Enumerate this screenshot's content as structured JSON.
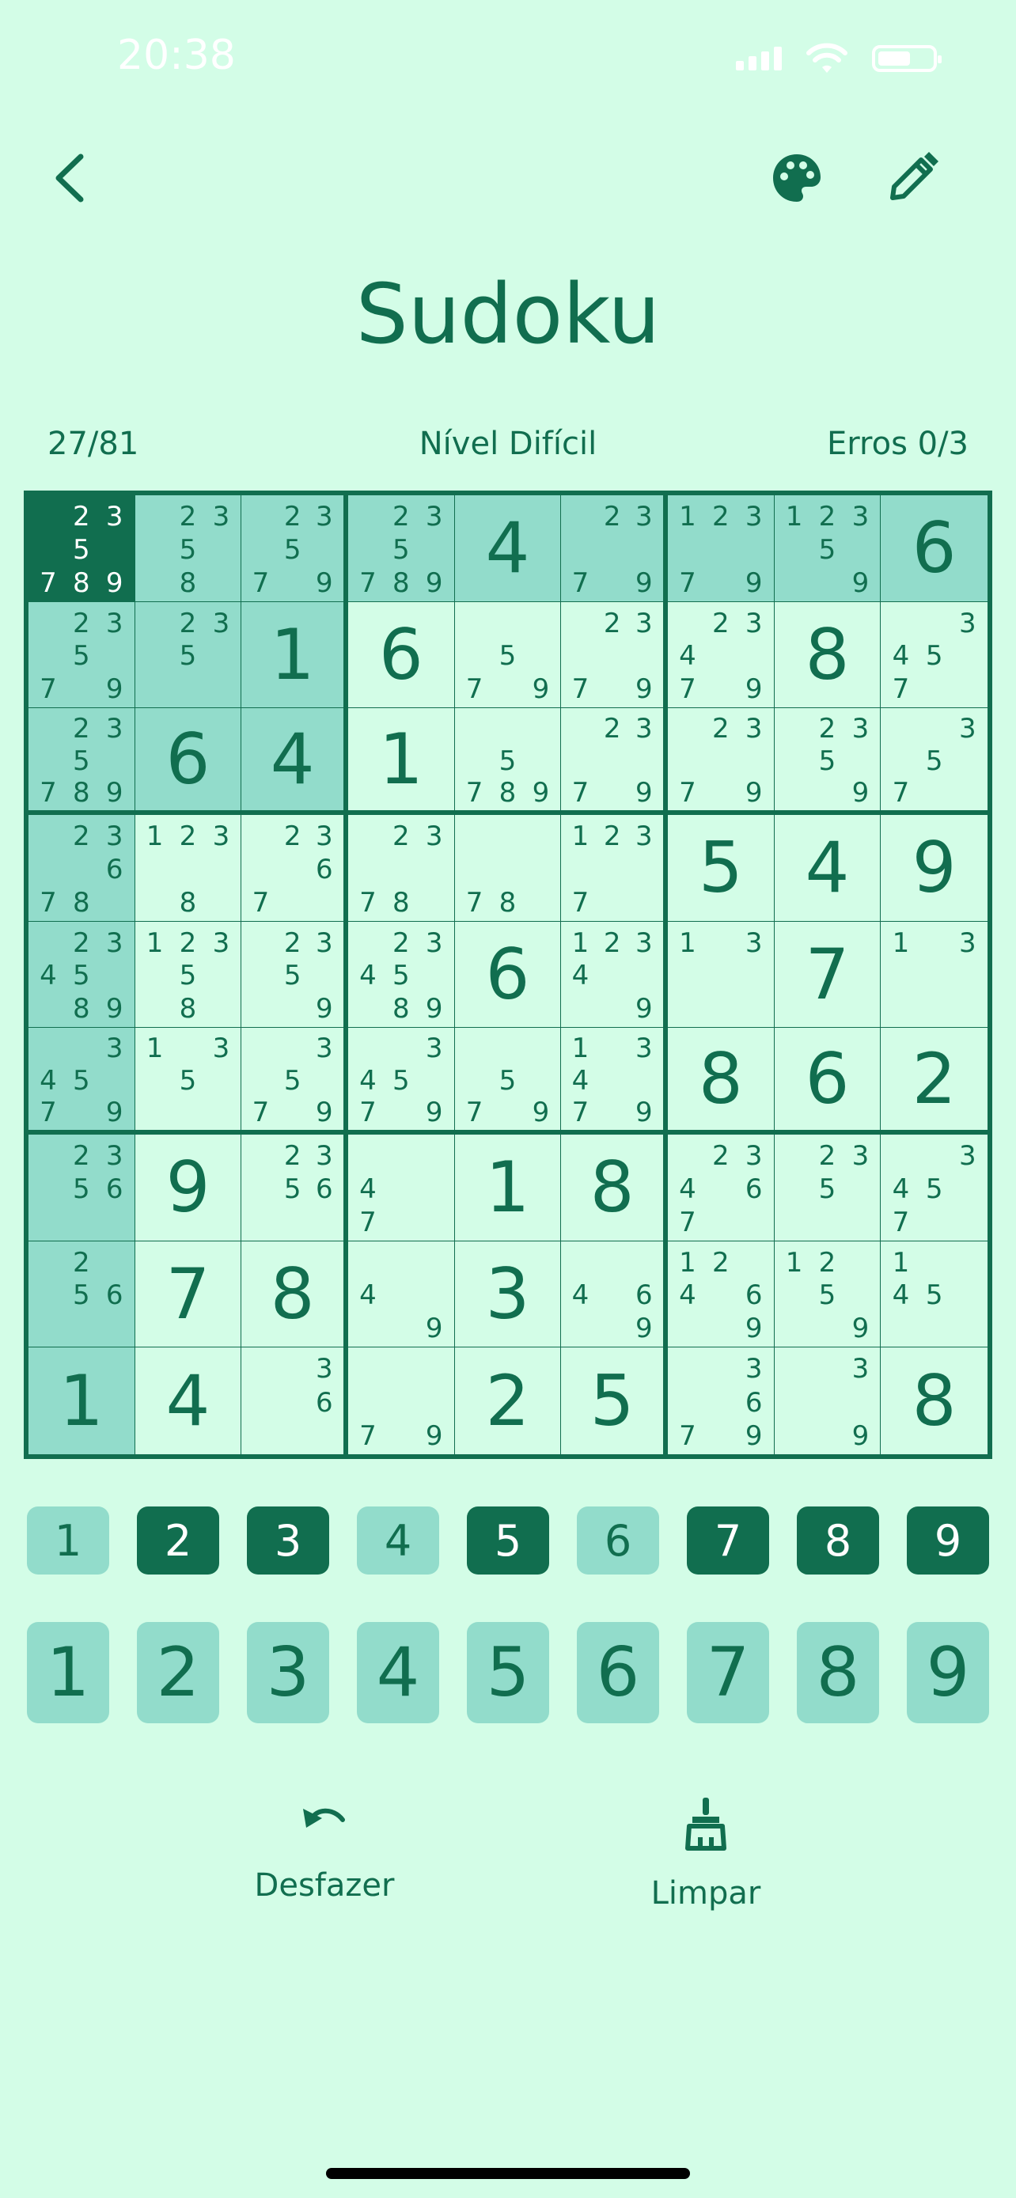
{
  "status": {
    "time": "20:38"
  },
  "header": {
    "title": "Sudoku"
  },
  "info": {
    "progress": "27/81",
    "level": "Nível Difícil",
    "errors": "Erros 0/3"
  },
  "colors": {
    "background": "#d3fde7",
    "accent": "#116e4f",
    "highlight": "#92dccb"
  },
  "board": [
    [
      {
        "n": [
          2,
          3,
          5,
          7,
          8,
          9
        ],
        "s": "sel"
      },
      {
        "n": [
          2,
          3,
          5,
          8
        ],
        "s": "hl"
      },
      {
        "n": [
          2,
          3,
          5,
          7,
          9
        ],
        "s": "hl"
      },
      {
        "n": [
          2,
          3,
          5,
          7,
          8,
          9
        ],
        "s": "hl"
      },
      {
        "v": "4",
        "s": "hl"
      },
      {
        "n": [
          2,
          3,
          7,
          9
        ],
        "s": "hl"
      },
      {
        "n": [
          1,
          2,
          3,
          7,
          9
        ],
        "s": "hl"
      },
      {
        "n": [
          1,
          2,
          3,
          5,
          9
        ],
        "s": "hl"
      },
      {
        "v": "6",
        "s": "hl"
      }
    ],
    [
      {
        "n": [
          2,
          3,
          5,
          7,
          9
        ],
        "s": "hl"
      },
      {
        "n": [
          2,
          3,
          5
        ],
        "s": "hl"
      },
      {
        "v": "1",
        "s": "hl"
      },
      {
        "v": "6"
      },
      {
        "n": [
          5,
          7,
          9
        ]
      },
      {
        "n": [
          2,
          3,
          7,
          9
        ]
      },
      {
        "n": [
          2,
          3,
          4,
          7,
          9
        ]
      },
      {
        "v": "8"
      },
      {
        "n": [
          3,
          4,
          5,
          7
        ]
      }
    ],
    [
      {
        "n": [
          2,
          3,
          5,
          7,
          8,
          9
        ],
        "s": "hl"
      },
      {
        "v": "6",
        "s": "hl"
      },
      {
        "v": "4",
        "s": "hl"
      },
      {
        "v": "1"
      },
      {
        "n": [
          5,
          7,
          8,
          9
        ]
      },
      {
        "n": [
          2,
          3,
          7,
          9
        ]
      },
      {
        "n": [
          2,
          3,
          7,
          9
        ]
      },
      {
        "n": [
          2,
          3,
          5,
          9
        ]
      },
      {
        "n": [
          3,
          5,
          7
        ]
      }
    ],
    [
      {
        "n": [
          2,
          3,
          6,
          7,
          8
        ],
        "s": "hl"
      },
      {
        "n": [
          1,
          2,
          3,
          8
        ]
      },
      {
        "n": [
          2,
          3,
          6,
          7
        ]
      },
      {
        "n": [
          2,
          3,
          7,
          8
        ]
      },
      {
        "n": [
          7,
          8
        ]
      },
      {
        "n": [
          1,
          2,
          3,
          7
        ]
      },
      {
        "v": "5"
      },
      {
        "v": "4"
      },
      {
        "v": "9"
      }
    ],
    [
      {
        "n": [
          2,
          3,
          4,
          5,
          8,
          9
        ],
        "s": "hl"
      },
      {
        "n": [
          1,
          2,
          3,
          5,
          8
        ]
      },
      {
        "n": [
          2,
          3,
          5,
          9
        ]
      },
      {
        "n": [
          2,
          3,
          4,
          5,
          8,
          9
        ]
      },
      {
        "v": "6"
      },
      {
        "n": [
          1,
          2,
          3,
          4,
          9
        ]
      },
      {
        "n": [
          1,
          3
        ]
      },
      {
        "v": "7"
      },
      {
        "n": [
          1,
          3
        ]
      }
    ],
    [
      {
        "n": [
          3,
          4,
          5,
          7,
          9
        ],
        "s": "hl"
      },
      {
        "n": [
          1,
          3,
          5
        ]
      },
      {
        "n": [
          3,
          5,
          7,
          9
        ]
      },
      {
        "n": [
          3,
          4,
          5,
          7,
          9
        ]
      },
      {
        "n": [
          5,
          7,
          9
        ]
      },
      {
        "n": [
          1,
          3,
          4,
          7,
          9
        ]
      },
      {
        "v": "8"
      },
      {
        "v": "6"
      },
      {
        "v": "2"
      }
    ],
    [
      {
        "n": [
          2,
          3,
          5,
          6
        ],
        "s": "hl"
      },
      {
        "v": "9"
      },
      {
        "n": [
          2,
          3,
          5,
          6
        ]
      },
      {
        "n": [
          4,
          7
        ]
      },
      {
        "v": "1"
      },
      {
        "v": "8"
      },
      {
        "n": [
          2,
          3,
          4,
          6,
          7
        ]
      },
      {
        "n": [
          2,
          3,
          5
        ]
      },
      {
        "n": [
          3,
          4,
          5,
          7
        ]
      }
    ],
    [
      {
        "n": [
          2,
          5,
          6
        ],
        "s": "hl"
      },
      {
        "v": "7"
      },
      {
        "v": "8"
      },
      {
        "n": [
          4,
          9
        ]
      },
      {
        "v": "3"
      },
      {
        "n": [
          4,
          6,
          9
        ]
      },
      {
        "n": [
          1,
          2,
          4,
          6,
          9
        ]
      },
      {
        "n": [
          1,
          2,
          5,
          9
        ]
      },
      {
        "n": [
          1,
          4,
          5
        ]
      }
    ],
    [
      {
        "v": "1",
        "s": "hl"
      },
      {
        "v": "4"
      },
      {
        "n": [
          3,
          6
        ]
      },
      {
        "n": [
          7,
          9
        ]
      },
      {
        "v": "2"
      },
      {
        "v": "5"
      },
      {
        "n": [
          3,
          6,
          7,
          9
        ]
      },
      {
        "n": [
          3,
          9
        ]
      },
      {
        "v": "8"
      }
    ]
  ],
  "note_keys": [
    {
      "label": "1",
      "style": "light"
    },
    {
      "label": "2",
      "style": "dark"
    },
    {
      "label": "3",
      "style": "dark"
    },
    {
      "label": "4",
      "style": "light"
    },
    {
      "label": "5",
      "style": "dark"
    },
    {
      "label": "6",
      "style": "light"
    },
    {
      "label": "7",
      "style": "dark"
    },
    {
      "label": "8",
      "style": "dark"
    },
    {
      "label": "9",
      "style": "dark"
    }
  ],
  "number_keys": [
    "1",
    "2",
    "3",
    "4",
    "5",
    "6",
    "7",
    "8",
    "9"
  ],
  "actions": {
    "undo": "Desfazer",
    "clear": "Limpar"
  }
}
